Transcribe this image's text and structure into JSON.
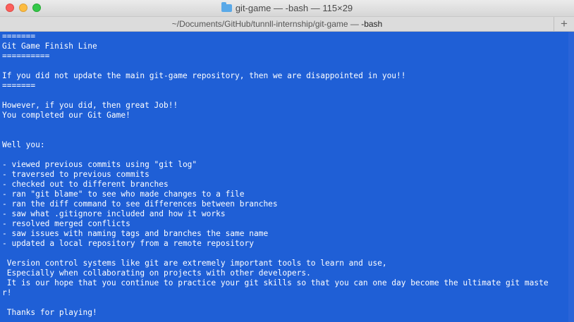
{
  "window": {
    "title": "git-game — -bash — 115×29",
    "folder_icon": "folder-icon"
  },
  "tab": {
    "path": "~/Documents/GitHub/tunnll-internship/git-game — ",
    "command": "-bash",
    "new_tab_label": "+"
  },
  "colors": {
    "terminal_background": "#1f5fd6",
    "terminal_text": "#ffffff"
  },
  "terminal": {
    "lines": [
      "=======",
      "Git Game Finish Line",
      "==========",
      "",
      "If you did not update the main git-game repository, then we are disappointed in you!!",
      "=======",
      "",
      "However, if you did, then great Job!!",
      "You completed our Git Game!",
      "",
      "",
      "Well you:",
      "",
      "- viewed previous commits using \"git log\"",
      "- traversed to previous commits",
      "- checked out to different branches",
      "- ran \"git blame\" to see who made changes to a file",
      "- ran the diff command to see differences between branches",
      "- saw what .gitignore included and how it works",
      "- resolved merged conflicts",
      "- saw issues with naming tags and branches the same name",
      "- updated a local repository from a remote repository",
      "",
      " Version control systems like git are extremely important tools to learn and use,",
      " Especially when collaborating on projects with other developers.",
      " It is our hope that you continue to practice your git skills so that you can one day become the ultimate git maste",
      "r!",
      "",
      " Thanks for playing!"
    ]
  }
}
